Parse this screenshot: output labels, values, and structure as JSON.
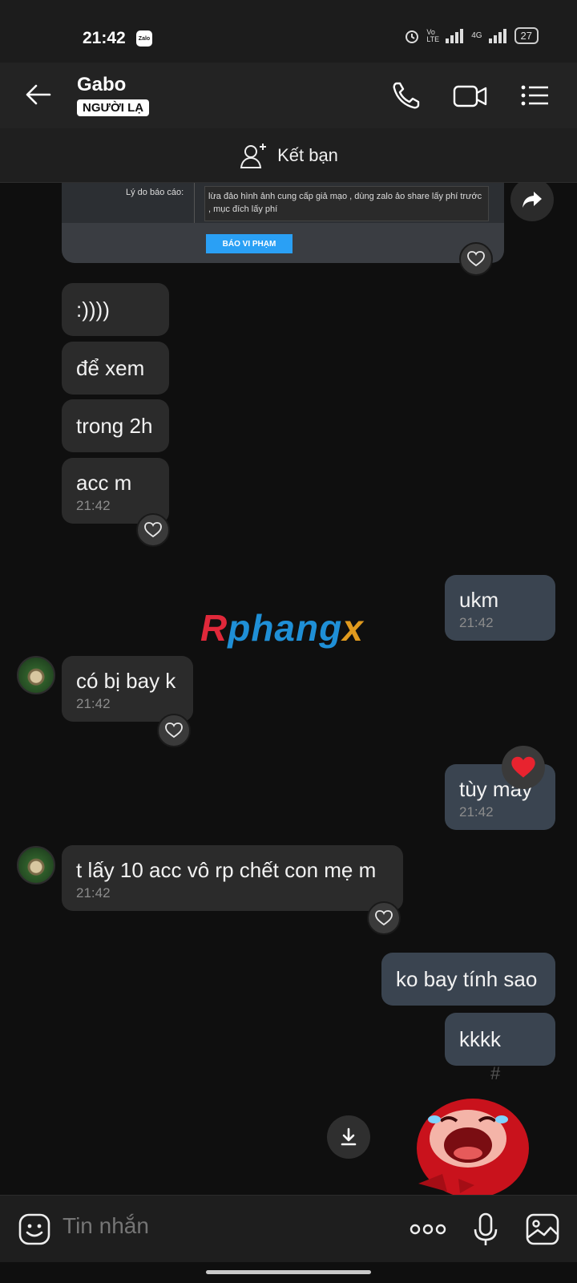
{
  "status_bar": {
    "time": "21:42",
    "app_badge": "Zalo",
    "network_volte": "Vo\nLTE",
    "network_4g": "4G",
    "battery": "27"
  },
  "header": {
    "contact_name": "Gabo",
    "stranger_label": "NGƯỜI LẠ"
  },
  "add_friend": {
    "label": "Kết bạn"
  },
  "report_card": {
    "label": "Lý do báo cáo:",
    "text": "lừa đảo hình ảnh cung cấp giả mạo , dùng zalo ảo share lấy phí trước , mục đích lấy phí",
    "button": "BÁO VI PHẠM"
  },
  "messages": [
    {
      "dir": "in",
      "text": ":))))"
    },
    {
      "dir": "in",
      "text": "để xem"
    },
    {
      "dir": "in",
      "text": "trong 2h"
    },
    {
      "dir": "in",
      "text": "acc m",
      "time": "21:42"
    },
    {
      "dir": "out",
      "text": "ukm",
      "time": "21:42"
    },
    {
      "dir": "in",
      "text": "có bị bay k",
      "time": "21:42"
    },
    {
      "dir": "out",
      "text": "tùy mày",
      "time": "21:42"
    },
    {
      "dir": "in",
      "text": "t lấy 10 acc vô rp chết con mẹ m",
      "time": "21:42"
    },
    {
      "dir": "out",
      "text": "ko bay tính sao"
    },
    {
      "dir": "out",
      "text": "kkkk"
    }
  ],
  "watermark": {
    "part1": "R",
    "part2": "phang",
    "part3": "x"
  },
  "composer": {
    "placeholder": "Tin nhắn"
  },
  "colors": {
    "incoming_bubble": "#2b2b2b",
    "outgoing_bubble": "#3a4450",
    "background": "#0f0f0f",
    "reaction_heart": "#e8232f"
  }
}
